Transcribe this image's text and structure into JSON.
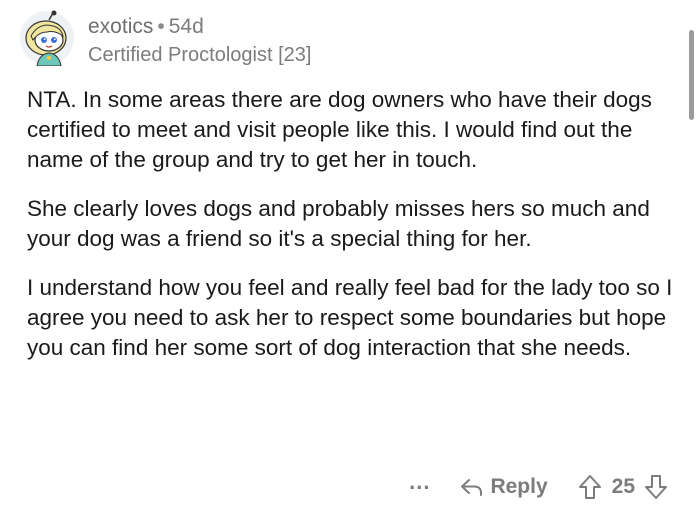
{
  "comment": {
    "username": "exotics",
    "separator": "•",
    "age": "54d",
    "flair": "Certified Proctologist [23]",
    "paragraphs": [
      "NTA. In some areas there are dog owners who have their dogs certified to meet and visit people like this.  I would find out the name of the group and try to get her in touch.",
      "She clearly loves dogs and probably misses hers so much and your dog was a friend so it's a special thing for her.",
      "I understand how you feel and really feel bad for the lady too so I agree you need to ask her to respect some boundaries but hope you can find her some sort of dog interaction that she needs."
    ]
  },
  "actions": {
    "more_label": "...",
    "reply_label": "Reply",
    "score": "25"
  },
  "icons": {
    "avatar": "snoo-avatar-icon",
    "reply": "reply-arrow-icon",
    "upvote": "upvote-arrow-icon",
    "downvote": "downvote-arrow-icon"
  },
  "colors": {
    "text": "#1a1a1b",
    "meta": "#7c7c7c",
    "avatar_hair": "#f3e9a8",
    "avatar_bg": "#e9eef2"
  }
}
